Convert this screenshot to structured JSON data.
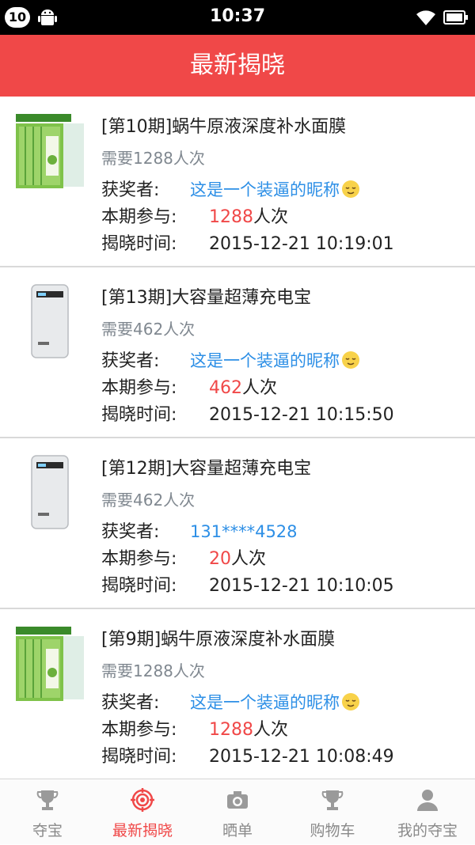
{
  "status_bar": {
    "notification_count": "10",
    "time": "10:37"
  },
  "header": {
    "title": "最新揭晓"
  },
  "labels": {
    "winner": "获奖者:",
    "participation": "本期参与:",
    "reveal_time": "揭晓时间:",
    "times_unit": "人次"
  },
  "items": [
    {
      "title": "[第10期]蜗牛原液深度补水面膜",
      "need": "需要1288人次",
      "winner": "这是一个装逼的昵称",
      "winner_has_emoji": true,
      "participation": "1288",
      "reveal_time": "2015-12-21 10:19:01",
      "image": "face-mask-product"
    },
    {
      "title": "[第13期]大容量超薄充电宝",
      "need": "需要462人次",
      "winner": "这是一个装逼的昵称",
      "winner_has_emoji": true,
      "participation": "462",
      "reveal_time": "2015-12-21 10:15:50",
      "image": "power-bank-product"
    },
    {
      "title": "[第12期]大容量超薄充电宝",
      "need": "需要462人次",
      "winner": "131****4528",
      "winner_has_emoji": false,
      "participation": "20",
      "reveal_time": "2015-12-21 10:10:05",
      "image": "power-bank-product"
    },
    {
      "title": "[第9期]蜗牛原液深度补水面膜",
      "need": "需要1288人次",
      "winner": "这是一个装逼的昵称",
      "winner_has_emoji": true,
      "participation": "1288",
      "reveal_time": "2015-12-21 10:08:49",
      "image": "face-mask-product"
    }
  ],
  "tabs": [
    {
      "label": "夺宝",
      "icon": "trophy-icon",
      "active": false
    },
    {
      "label": "最新揭晓",
      "icon": "target-icon",
      "active": true
    },
    {
      "label": "晒单",
      "icon": "camera-icon",
      "active": false
    },
    {
      "label": "购物车",
      "icon": "cart-trophy-icon",
      "active": false
    },
    {
      "label": "我的夺宝",
      "icon": "user-icon",
      "active": false
    }
  ],
  "colors": {
    "accent": "#f04848",
    "link": "#2d8fe6",
    "muted": "#808890"
  }
}
